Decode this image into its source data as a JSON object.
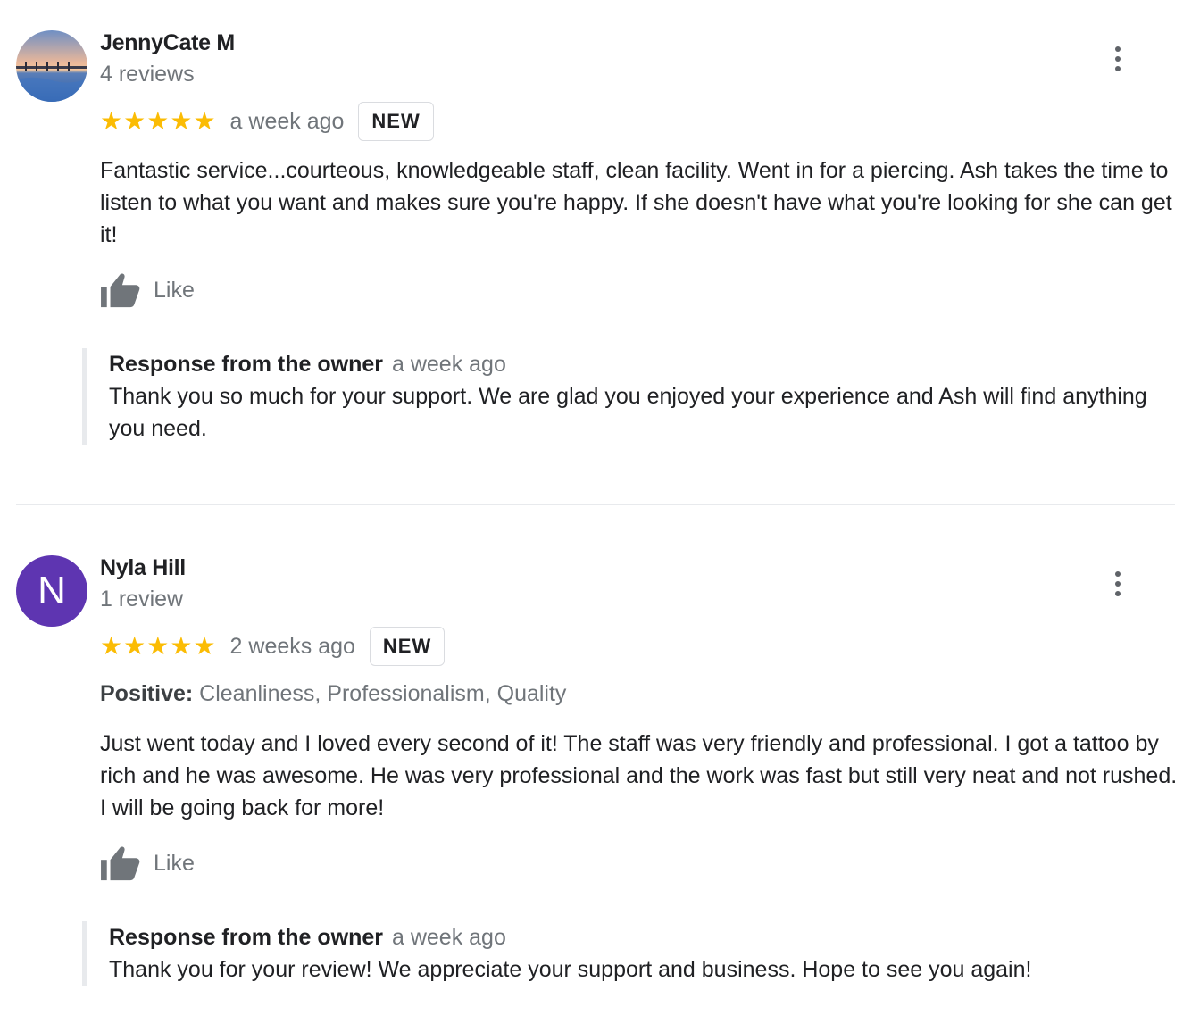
{
  "reviews": [
    {
      "author": "JennyCate M",
      "review_count": "4 reviews",
      "rating": 5,
      "time": "a week ago",
      "badge": "NEW",
      "text": "Fantastic service...courteous, knowledgeable staff, clean facility. Went in for a piercing. Ash takes the time to listen to what you want and makes sure you're happy. If she doesn't have what you're looking for she can get it!",
      "like_label": "Like",
      "owner_response": {
        "heading": "Response from the owner",
        "time": "a week ago",
        "text": "Thank you so much for your support. We are glad you enjoyed your experience and Ash will find anything you need."
      }
    },
    {
      "author": "Nyla Hill",
      "avatar_letter": "N",
      "review_count": "1 review",
      "rating": 5,
      "time": "2 weeks ago",
      "badge": "NEW",
      "highlights_label": "Positive:",
      "highlights": "Cleanliness, Professionalism, Quality",
      "text": "Just went today and I loved every second of it! The staff was very friendly and professional. I got a tattoo by rich and he was awesome. He was very professional and the work was fast but still very neat and not rushed. I will be going back for more!",
      "like_label": "Like",
      "owner_response": {
        "heading": "Response from the owner",
        "time": "a week ago",
        "text": "Thank you for your review! We appreciate your support and business. Hope to see you again!"
      }
    }
  ],
  "colors": {
    "star": "#fbbc04",
    "avatar_purple": "#5e35b1",
    "secondary_text": "#70757a"
  },
  "icons": {
    "like": "thumbs-up-icon",
    "menu": "more-vert-icon",
    "star": "star-icon"
  }
}
